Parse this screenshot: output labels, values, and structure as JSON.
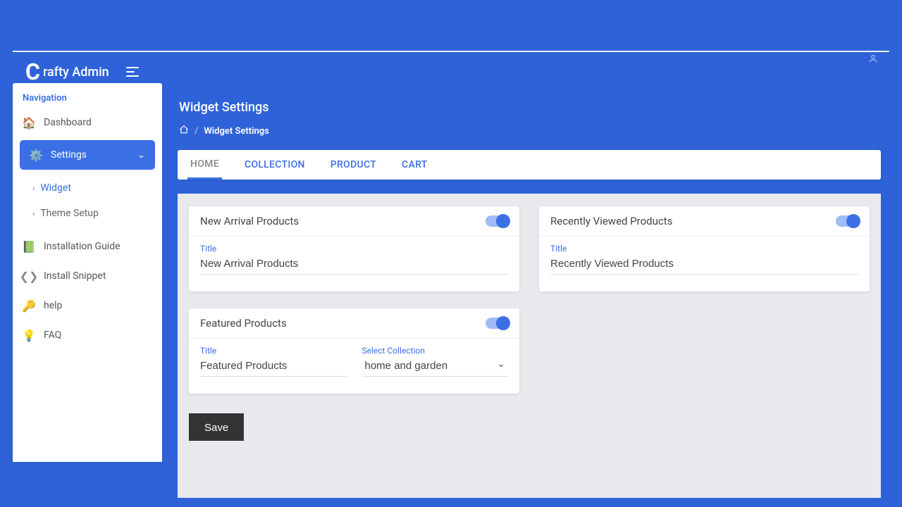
{
  "brand": {
    "mark": "C",
    "text": "rafty Admin"
  },
  "sidebar": {
    "heading": "Navigation",
    "dashboard": "Dashboard",
    "settings": "Settings",
    "submenu": {
      "widget": "Widget",
      "theme": "Theme Setup"
    },
    "install_guide": "Installation Guide",
    "install_snippet": "Install Snippet",
    "help": "help",
    "faq": "FAQ"
  },
  "page": {
    "title": "Widget Settings",
    "breadcrumb_current": "Widget Settings",
    "sep": "/"
  },
  "tabs": {
    "home": "HOME",
    "collection": "COLLECTION",
    "product": "PRODUCT",
    "cart": "CART"
  },
  "cards": {
    "new_arrival": {
      "title": "New Arrival Products",
      "field_label": "Title",
      "field_value": "New Arrival Products"
    },
    "recently_viewed": {
      "title": "Recently Viewed Products",
      "field_label": "Title",
      "field_value": "Recently Viewed Products"
    },
    "featured": {
      "title": "Featured Products",
      "title_label": "Title",
      "title_value": "Featured Products",
      "collection_label": "Select Collection",
      "collection_value": "home and garden"
    }
  },
  "actions": {
    "save": "Save"
  }
}
